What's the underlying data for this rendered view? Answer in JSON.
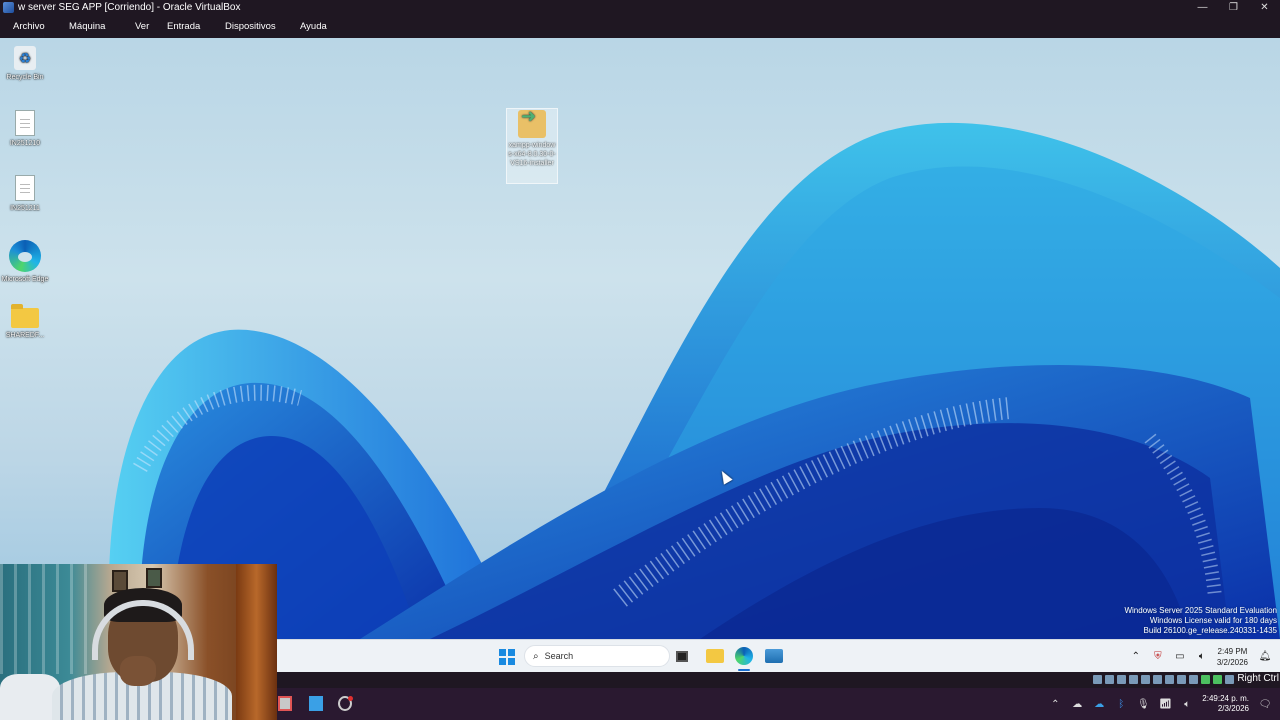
{
  "host_window": {
    "title": "w server SEG APP [Corriendo] - Oracle VirtualBox",
    "controls": {
      "minimize": "—",
      "restore": "❐",
      "close": "✕"
    },
    "menu": [
      "Archivo",
      "Máquina",
      "Ver",
      "Entrada",
      "Dispositivos",
      "Ayuda"
    ]
  },
  "desktop": {
    "icons": [
      {
        "label": "Recycle Bin",
        "icon": "recycle-bin-icon"
      },
      {
        "label": "IN251210",
        "icon": "document-icon"
      },
      {
        "label": "IN251211",
        "icon": "document-icon"
      },
      {
        "label": "Microsoft Edge",
        "icon": "edge-icon"
      },
      {
        "label": "SHAREDF...",
        "icon": "folder-icon"
      },
      {
        "label": "xampp-windows-x64-8.0.30-0-VS16-installer",
        "icon": "installer-icon"
      }
    ],
    "watermark": {
      "line1": "Windows Server 2025 Standard Evaluation",
      "line2": "Windows License valid for 180 days",
      "line3": "Build 26100.ge_release.240331-1435"
    }
  },
  "guest_taskbar": {
    "search_placeholder": "Search",
    "apps": [
      "start-icon",
      "task-view-icon",
      "file-explorer-icon",
      "edge-icon",
      "server-manager-icon"
    ],
    "tray": {
      "icons": [
        "chevron-up-icon",
        "security-icon",
        "network-icon",
        "volume-icon"
      ],
      "time": "2:49 PM",
      "date": "3/2/2026"
    }
  },
  "vbox_status": {
    "host_key": "Right Ctrl"
  },
  "host_taskbar": {
    "apps": [
      "virtualbox-icon",
      "notepad-icon",
      "obs-icon"
    ],
    "tray": {
      "icons": [
        "chevron-up-icon",
        "cloud-icon",
        "onedrive-icon",
        "bluetooth-icon",
        "mic-icon",
        "wifi-icon",
        "speaker-icon"
      ],
      "time": "2:49:24 p. m.",
      "date": "2/3/2026"
    }
  },
  "colors": {
    "host_chrome": "#1f1722",
    "guest_taskbar": "#eef2f6",
    "accent": "#1a8ae0"
  }
}
